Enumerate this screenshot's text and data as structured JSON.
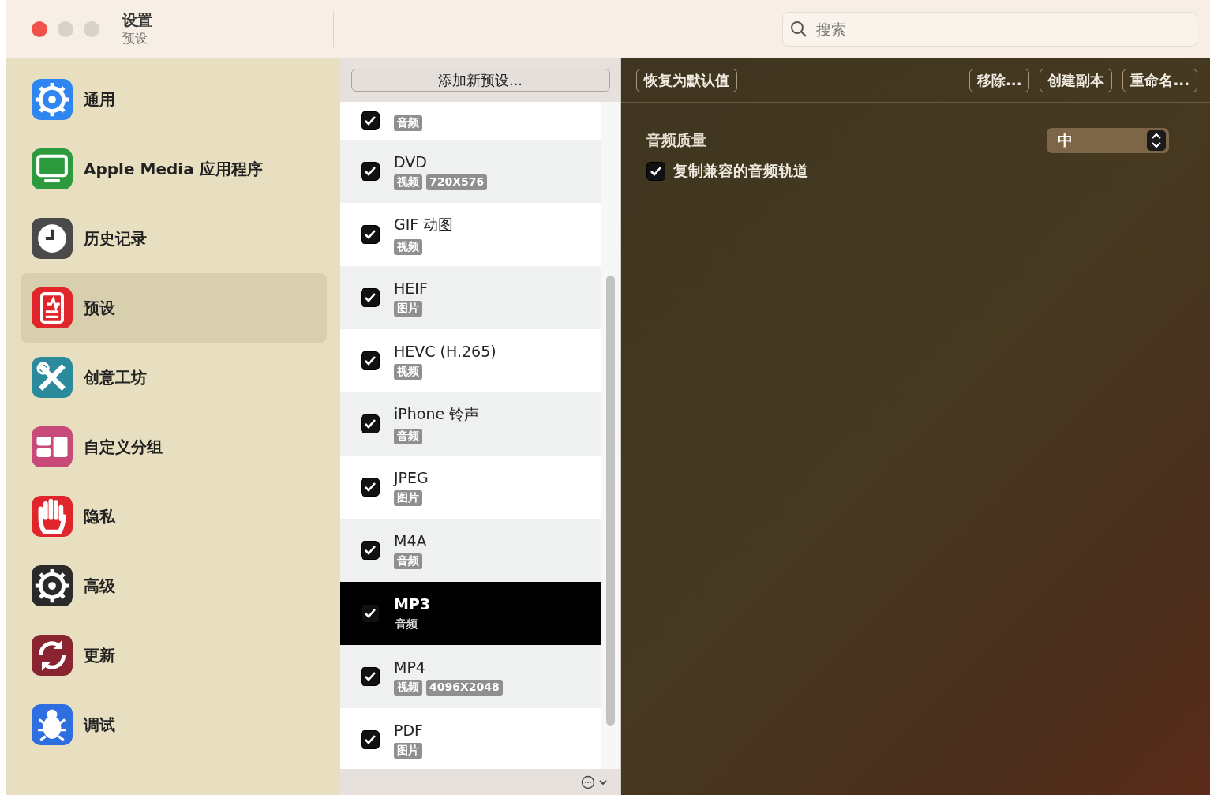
{
  "window": {
    "title": "设置",
    "subtitle": "预设"
  },
  "search": {
    "placeholder": "搜索"
  },
  "sidebar": {
    "items": [
      {
        "label": "通用",
        "kind": "gear",
        "color": "#2f86f0",
        "selected": false
      },
      {
        "label": "Apple Media 应用程序",
        "kind": "display",
        "color": "#2e9a3e",
        "selected": false
      },
      {
        "label": "历史记录",
        "kind": "clock",
        "color": "#4a4a4a",
        "selected": false
      },
      {
        "label": "预设",
        "kind": "doc",
        "color": "#e0262a",
        "selected": true
      },
      {
        "label": "创意工坊",
        "kind": "tools",
        "color": "#2b8a9c",
        "selected": false
      },
      {
        "label": "自定义分组",
        "kind": "blocks",
        "color": "#c84a7a",
        "selected": false
      },
      {
        "label": "隐私",
        "kind": "hand",
        "color": "#e0262a",
        "selected": false
      },
      {
        "label": "高级",
        "kind": "gear",
        "color": "#2a2a2a",
        "selected": false
      },
      {
        "label": "更新",
        "kind": "sync",
        "color": "#8a2430",
        "selected": false
      },
      {
        "label": "调试",
        "kind": "bug",
        "color": "#2f6ee0",
        "selected": false
      }
    ]
  },
  "presets": {
    "add_button": "添加新预设...",
    "items": [
      {
        "tags": [
          "音频"
        ],
        "checked": true,
        "selected": false
      },
      {
        "name": "DVD",
        "tags": [
          "视频",
          "720X576"
        ],
        "checked": true,
        "selected": false
      },
      {
        "name": "GIF 动图",
        "tags": [
          "视频"
        ],
        "checked": true,
        "selected": false
      },
      {
        "name": "HEIF",
        "tags": [
          "图片"
        ],
        "checked": true,
        "selected": false
      },
      {
        "name": "HEVC (H.265)",
        "tags": [
          "视频"
        ],
        "checked": true,
        "selected": false
      },
      {
        "name": "iPhone 铃声",
        "tags": [
          "音频"
        ],
        "checked": true,
        "selected": false
      },
      {
        "name": "JPEG",
        "tags": [
          "图片"
        ],
        "checked": true,
        "selected": false
      },
      {
        "name": "M4A",
        "tags": [
          "音频"
        ],
        "checked": true,
        "selected": false
      },
      {
        "name": "MP3",
        "tags": [
          "音频"
        ],
        "checked": true,
        "selected": true
      },
      {
        "name": "MP4",
        "tags": [
          "视频",
          "4096X2048"
        ],
        "checked": true,
        "selected": false
      },
      {
        "name": "PDF",
        "tags": [
          "图片"
        ],
        "checked": true,
        "selected": false
      }
    ]
  },
  "toolbar": {
    "left": [
      "恢复为默认值"
    ],
    "right": [
      "移除...",
      "创建副本",
      "重命名..."
    ]
  },
  "settings": {
    "quality_label": "音频质量",
    "quality_value": "中",
    "copy_track": {
      "label": "复制兼容的音频轨道",
      "checked": true
    }
  }
}
